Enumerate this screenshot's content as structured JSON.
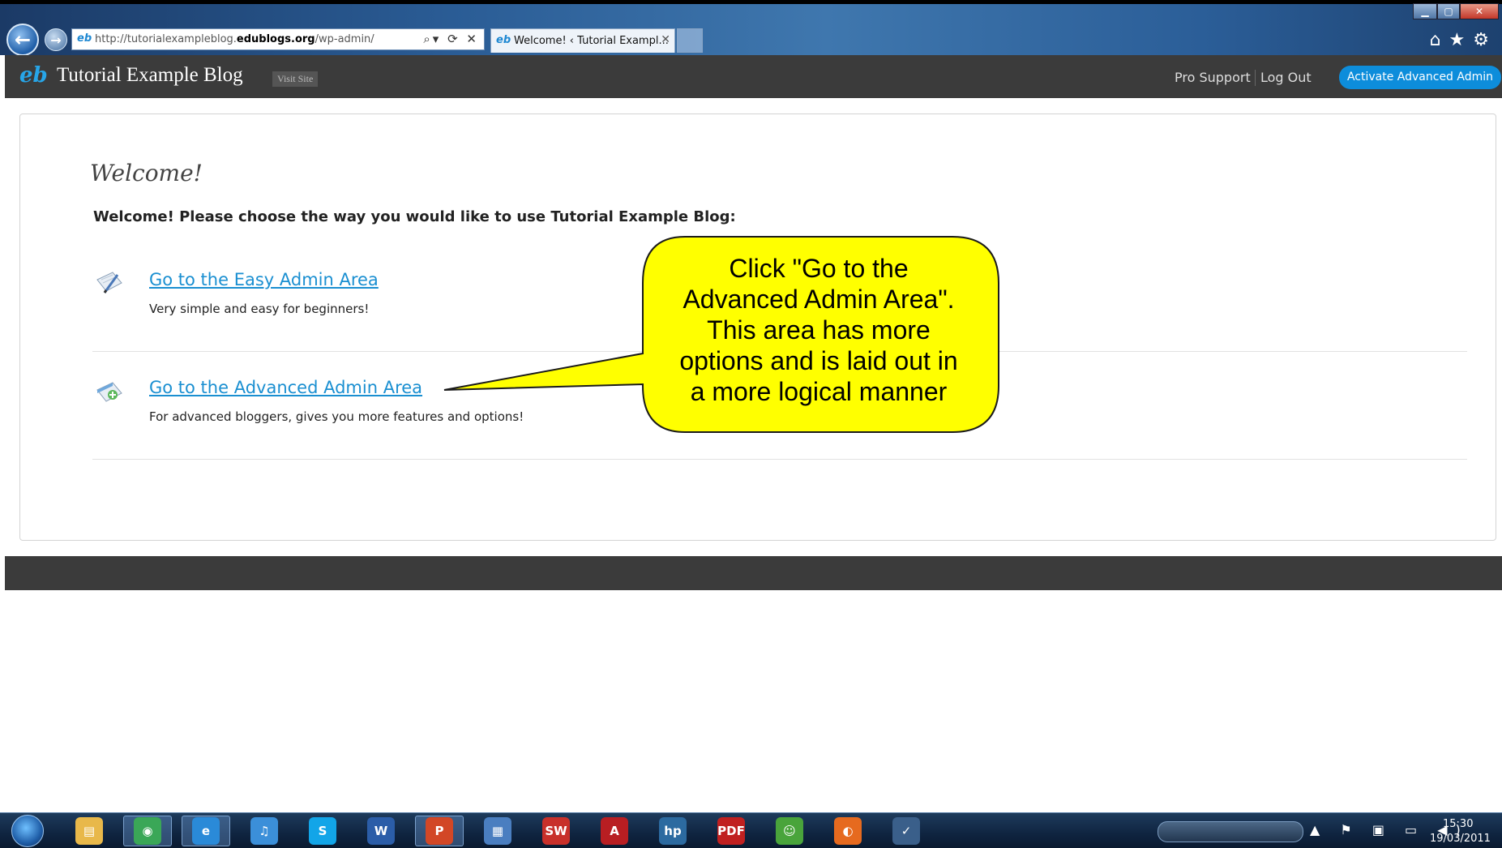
{
  "browser": {
    "url_prefix": "http://tutorialexampleblog.",
    "url_domain": "edublogs.org",
    "url_path": "/wp-admin/",
    "tab_title": "Welcome! ‹ Tutorial Exampl...",
    "favicon_glyph": "eb",
    "address_tools": "⌕▾ ⟳ ✕",
    "right_icons": "⌂★⚙",
    "window_buttons": {
      "minimize": "▁",
      "maximize": "▢",
      "close": "✕"
    }
  },
  "admin_bar": {
    "logo_glyph": "eb",
    "site_title": "Tutorial Example Blog",
    "visit_site": "Visit Site",
    "pro_support": "Pro Support",
    "logout": "Log Out",
    "activate_button": "Activate Advanced Admin"
  },
  "main": {
    "title": "Welcome!",
    "intro": "Welcome! Please choose the way you would like to use Tutorial Example Blog:",
    "options": [
      {
        "label": "Go to the Easy Admin Area",
        "description": "Very simple and easy for beginners!",
        "icon": "notepad-pencil-icon"
      },
      {
        "label": "Go to the Advanced Admin Area",
        "description": "For advanced bloggers, gives you more features and options!",
        "icon": "notepad-plus-icon"
      }
    ]
  },
  "callout": {
    "lines": [
      "Click \"Go to the",
      "Advanced Admin Area\".",
      "This area has more",
      "options and is laid out in",
      "a more logical manner"
    ],
    "fill_color": "#ffff00"
  },
  "taskbar": {
    "apps": [
      {
        "name": "explorer",
        "glyph": "▤",
        "color": "#e8b84a"
      },
      {
        "name": "chrome",
        "glyph": "◉",
        "color": "#3aa757"
      },
      {
        "name": "internet-explorer",
        "glyph": "e",
        "color": "#2a8ad8"
      },
      {
        "name": "itunes",
        "glyph": "♫",
        "color": "#3b8fd9"
      },
      {
        "name": "skype",
        "glyph": "S",
        "color": "#12a5e8"
      },
      {
        "name": "word",
        "glyph": "W",
        "color": "#2b5da8"
      },
      {
        "name": "powerpoint",
        "glyph": "P",
        "color": "#d24726"
      },
      {
        "name": "project",
        "glyph": "▦",
        "color": "#4a7ec0"
      },
      {
        "name": "solidworks",
        "glyph": "SW",
        "color": "#c8302a"
      },
      {
        "name": "autocad",
        "glyph": "A",
        "color": "#b81e22"
      },
      {
        "name": "hp",
        "glyph": "hp",
        "color": "#2c6aa0"
      },
      {
        "name": "pdf-tool",
        "glyph": "PDF",
        "color": "#c02020"
      },
      {
        "name": "messenger",
        "glyph": "☺",
        "color": "#49a43b"
      },
      {
        "name": "firefox",
        "glyph": "◐",
        "color": "#e66a1f"
      },
      {
        "name": "clock-app",
        "glyph": "✓",
        "color": "#3a5f8a"
      }
    ],
    "tray": "▲ ⚑ ▣ ▭ ◀)",
    "time": "15:30",
    "date": "19/03/2011"
  }
}
